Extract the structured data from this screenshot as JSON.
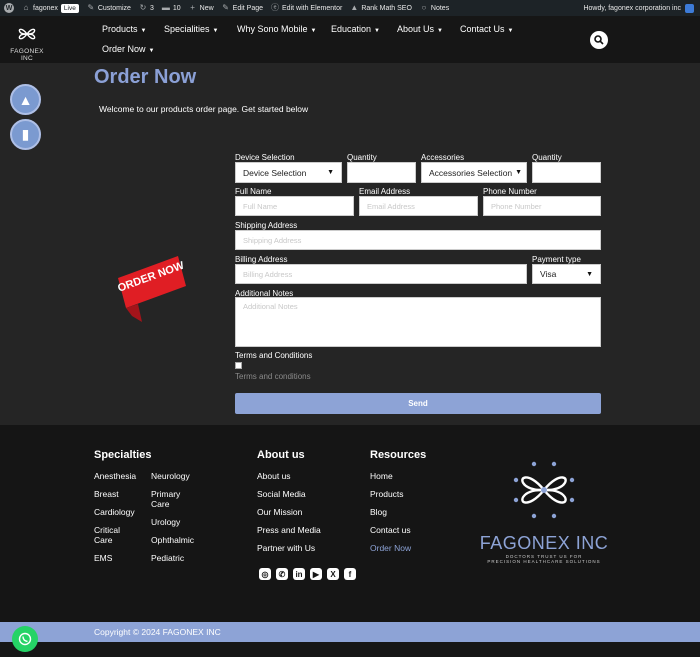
{
  "adminbar": {
    "site": "fagonex",
    "live": "Live",
    "customize": "Customize",
    "updates": "3",
    "comments": "10",
    "new": "New",
    "edit_page": "Edit Page",
    "elementor": "Edit with Elementor",
    "seo": "Rank Math SEO",
    "notes": "Notes",
    "howdy": "Howdy, fagonex corporation inc"
  },
  "brand": {
    "logo_text": "FAGONEX INC"
  },
  "nav": {
    "items": [
      {
        "label": "Products"
      },
      {
        "label": "Specialities"
      },
      {
        "label": "Why Sono Mobile"
      },
      {
        "label": "Education"
      },
      {
        "label": "About Us"
      },
      {
        "label": "Contact Us"
      },
      {
        "label": "Order Now"
      }
    ]
  },
  "page": {
    "title": "Order Now",
    "welcome": "Welcome to our products order page. Get started below"
  },
  "form": {
    "device_label": "Device Selection",
    "device_value": "Device Selection",
    "quantity_label": "Quantity",
    "accessories_label": "Accessories",
    "accessories_value": "Accessories Selection",
    "quantity2_label": "Quantity",
    "fullname_label": "Full Name",
    "fullname_placeholder": "Full Name",
    "email_label": "Email Address",
    "email_placeholder": "Email Address",
    "phone_label": "Phone Number",
    "phone_placeholder": "Phone Number",
    "shipping_label": "Shipping Address",
    "shipping_placeholder": "Shipping Address",
    "billing_label": "Billing Address",
    "billing_placeholder": "Billing Address",
    "payment_label": "Payment type",
    "payment_value": "Visa",
    "notes_label": "Additional Notes",
    "notes_placeholder": "Additional Notes",
    "terms_label": "Terms and Conditions",
    "terms_link": "Terms and conditions",
    "send": "Send"
  },
  "ribbon": {
    "text": "ORDER NOW"
  },
  "footer": {
    "specialties": {
      "title": "Specialties",
      "col1": [
        "Anesthesia",
        "Breast",
        "Cardiology",
        "Critical",
        "Care",
        "EMS"
      ],
      "col2": [
        "Neurology",
        "Primary",
        "Care",
        "Urology",
        "Ophthalmic",
        "Pediatric"
      ]
    },
    "about": {
      "title": "About us",
      "links": [
        "About us",
        "Social Media",
        "Our Mission",
        "Press and Media",
        "Partner with Us"
      ]
    },
    "resources": {
      "title": "Resources",
      "links": [
        "Home",
        "Products",
        "Blog",
        "Contact us",
        "Order Now"
      ]
    },
    "logo": {
      "name": "FAGONEX INC",
      "tagline1": "DOCTORS TRUST US FOR",
      "tagline2": "PRECISION HEALTHCARE SOLUTIONS"
    },
    "social_icons": [
      "instagram-icon",
      "whatsapp-icon",
      "linkedin-icon",
      "youtube-icon",
      "x-icon",
      "facebook-icon"
    ],
    "copyright": "Copyright © 2024 FAGONEX INC"
  },
  "colors": {
    "accent": "#8da3d6",
    "header_bg": "#161616",
    "body_bg": "#252525",
    "whatsapp": "#25d366",
    "ribbon": "#e01e24"
  }
}
